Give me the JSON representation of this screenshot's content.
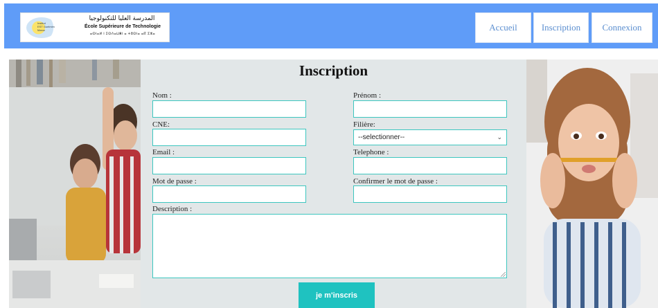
{
  "header": {
    "logo": {
      "emblem_text": "Institut\nEST Guelmim\nMaroc",
      "arabic_name": "المدرسة العليا للتكنولوجيا",
      "french_name": "École Supérieure de Technologie",
      "tifinagh_name": "ⴰⵙⵏⴰⵍ ⵏ ⵉⵙⴷⴰⵡⴻⵏ ⴰ ⵜⵓⵙⵏⴰ ⴰⴽ ⵉⵣⴰ"
    },
    "nav": {
      "accueil": "Accueil",
      "inscription": "Inscription",
      "connexion": "Connexion"
    }
  },
  "form": {
    "title": "Inscription",
    "nom_label": "Nom :",
    "nom_value": "",
    "prenom_label": "Prénom :",
    "prenom_value": "",
    "cne_label": "CNE:",
    "cne_value": "",
    "filiere_label": "Filière:",
    "filiere_selected": "--selectionner--",
    "email_label": "Email :",
    "email_value": "",
    "telephone_label": "Telephone :",
    "telephone_value": "",
    "password_label": "Mot de passe :",
    "confirm_label": "Confirmer le mot de passe :",
    "description_label": "Description :",
    "submit_label": "je m'inscris"
  },
  "colors": {
    "header_bg": "#5f9cf8",
    "nav_text": "#5c8fd0",
    "panel_bg": "#e2e7e8",
    "input_border": "#3cc6bf",
    "button_bg": "#1fc2c0"
  }
}
